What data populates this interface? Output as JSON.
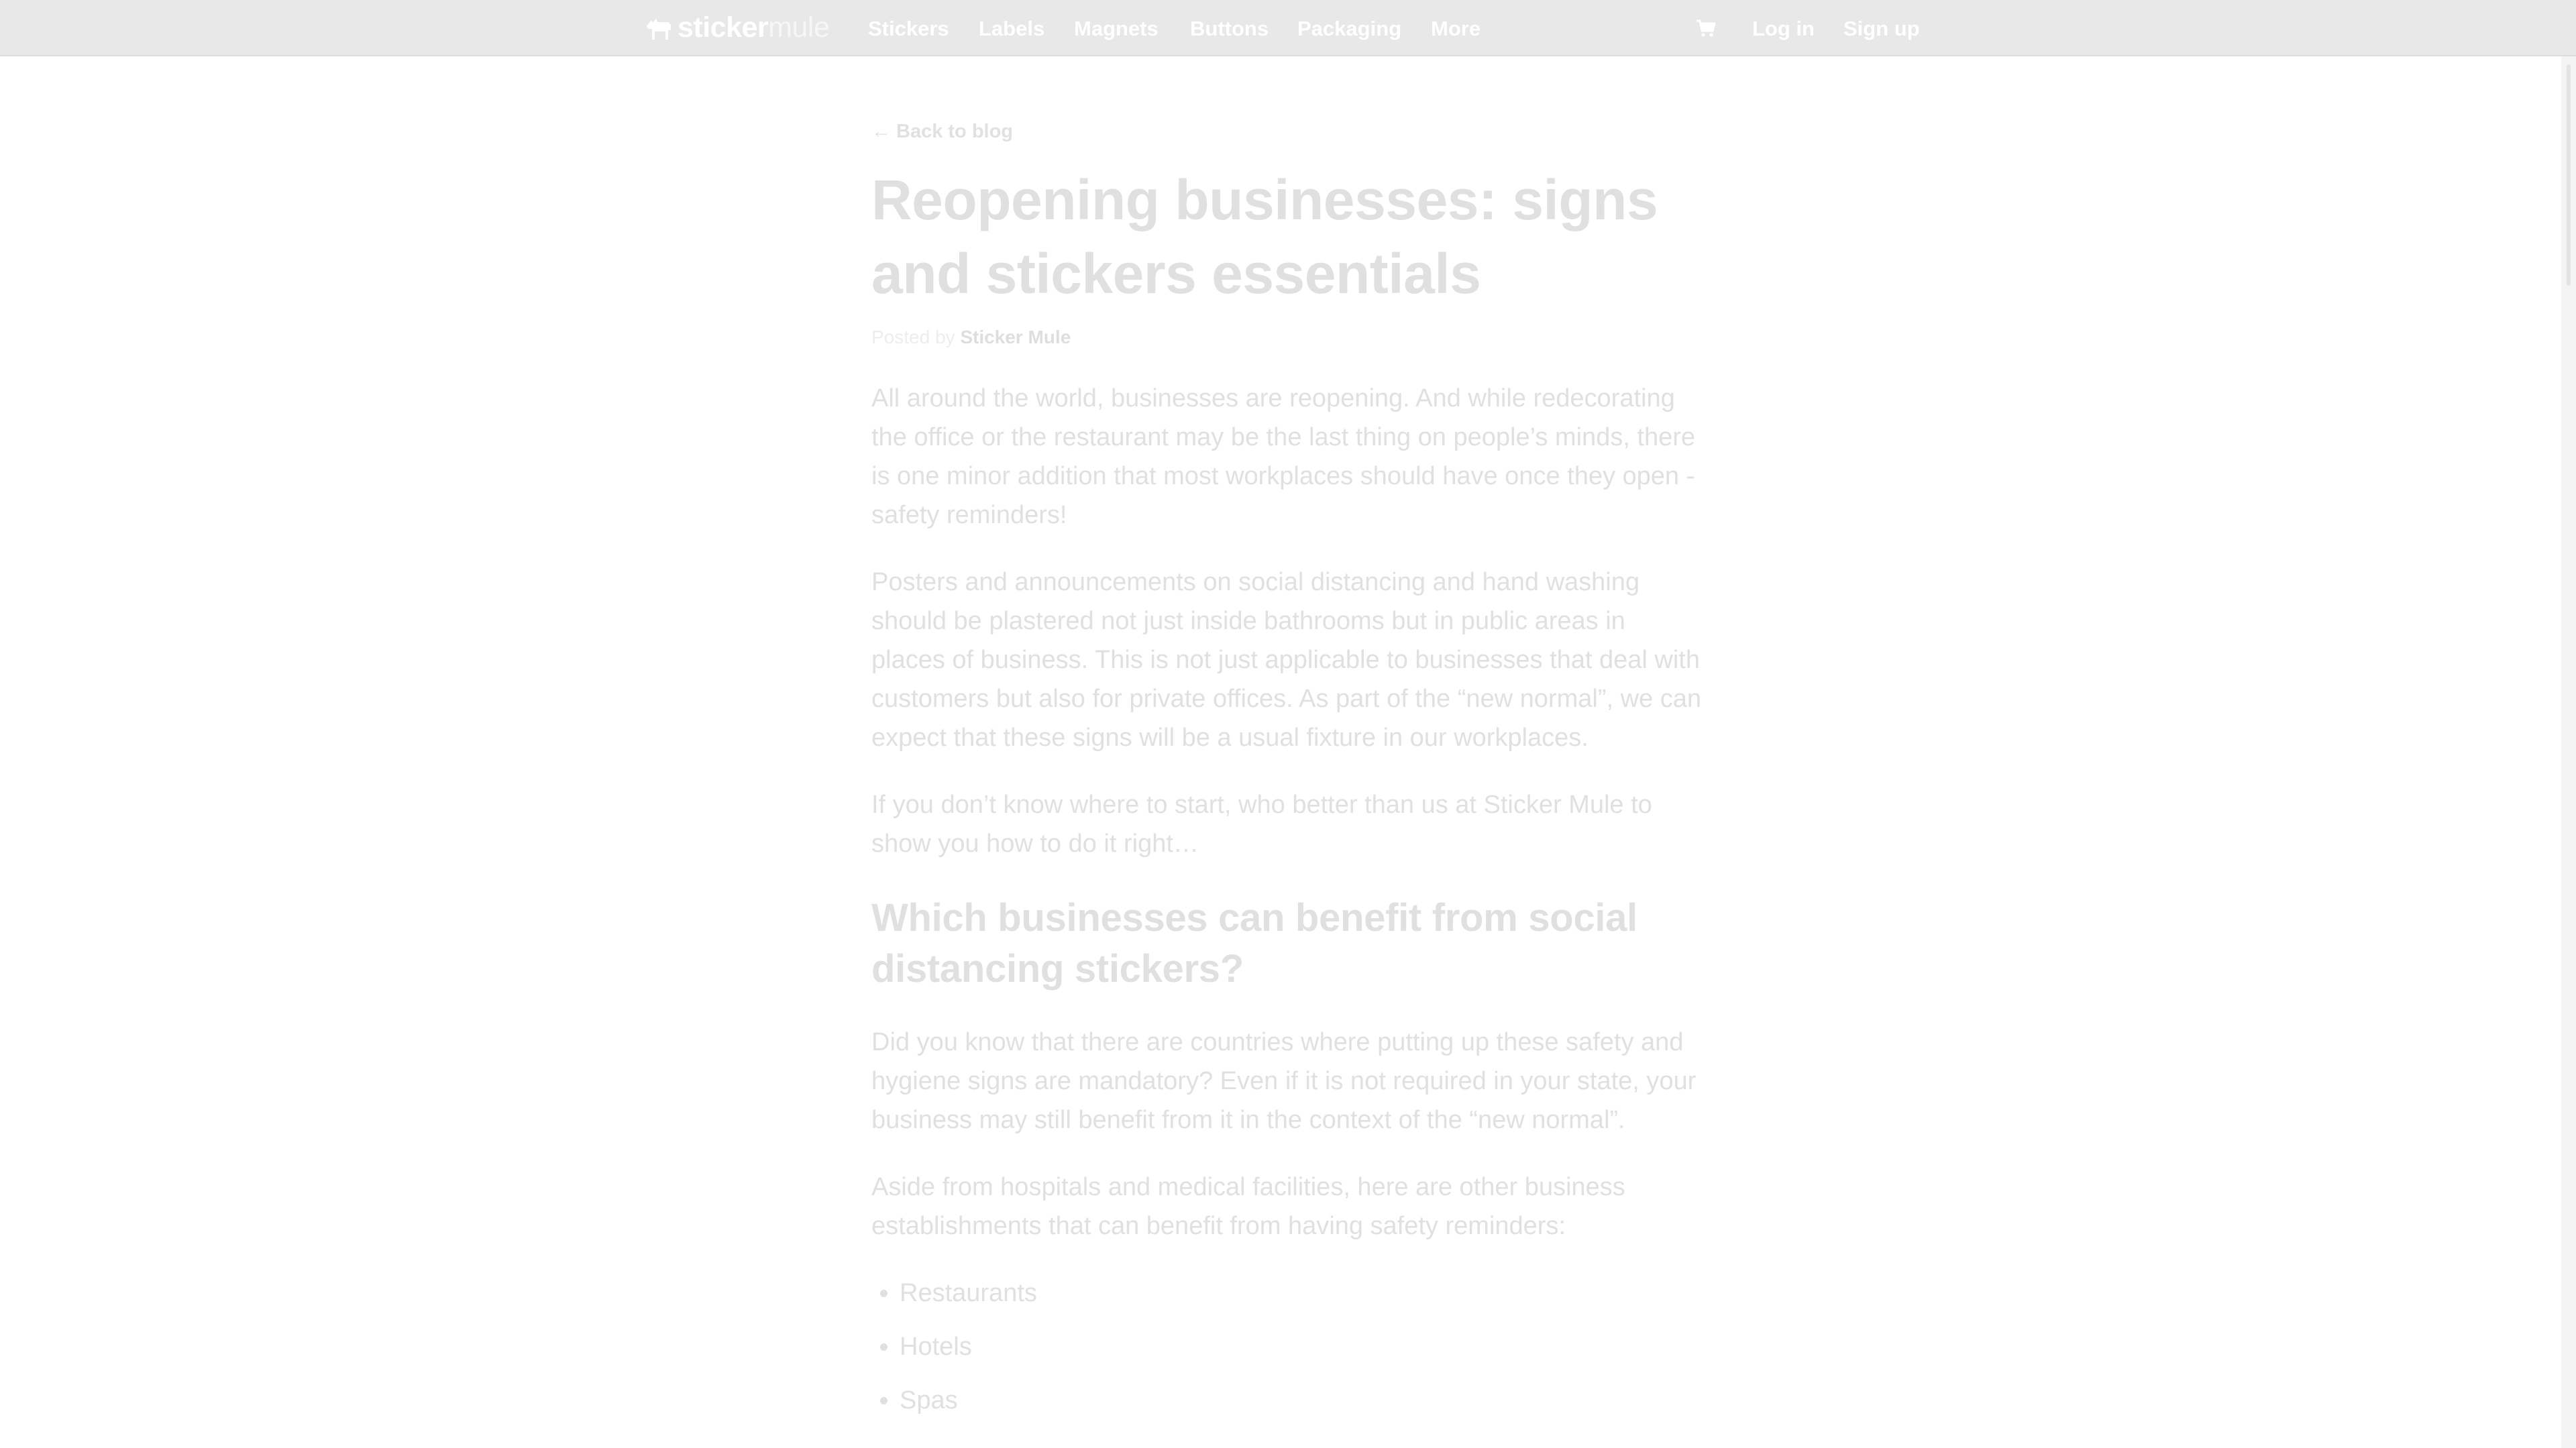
{
  "brand": {
    "name_first": "sticker",
    "name_second": "mule"
  },
  "nav": {
    "items": [
      {
        "label": "Stickers"
      },
      {
        "label": "Labels"
      },
      {
        "label": "Magnets"
      },
      {
        "label": "Buttons"
      },
      {
        "label": "Packaging"
      },
      {
        "label": "More"
      }
    ],
    "cart_icon": "shopping-cart-icon",
    "login_label": "Log in",
    "signup_label": "Sign up"
  },
  "article": {
    "back_label": "Back to blog",
    "back_arrow": "←",
    "title": "Reopening businesses: signs and stickers essentials",
    "byline_prefix": "Posted by",
    "byline_author": "Sticker Mule",
    "paragraphs": [
      "All around the world, businesses are reopening. And while redecorating the office or the restaurant may be the last thing on people’s minds, there is one minor addition that most workplaces should have once they open - safety reminders!",
      "Posters and announcements on social distancing and hand washing should be plastered not just inside bathrooms but in public areas in places of business. This is not just applicable to businesses that deal with customers but also for private offices. As part of the “new normal”, we can expect that these signs will be a usual fixture in our workplaces.",
      "If you don’t know where to start, who better than us at Sticker Mule to show you how to do it right…"
    ],
    "subheading": "Which businesses can benefit from social distancing stickers?",
    "paragraphs_2": [
      "Did you know that there are countries where putting up these safety and hygiene signs are mandatory? Even if it is not required in your state, your business may still benefit from it in the context of the “new normal”.",
      "Aside from hospitals and medical facilities, here are other business establishments that can benefit from having safety reminders:"
    ],
    "list": [
      "Restaurants",
      "Hotels",
      "Spas"
    ]
  },
  "colors": {
    "topbar": "#e8e8e8",
    "overlay_text": "#e0e0e0"
  }
}
